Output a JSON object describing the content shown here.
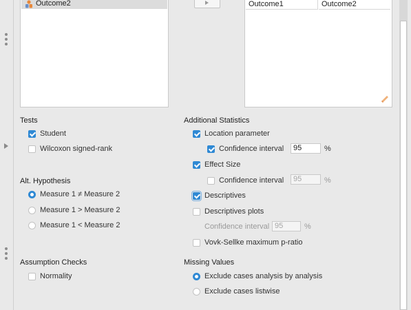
{
  "variables": {
    "items": [
      {
        "label": "Outcome2",
        "icon": "scale-variable-icon"
      }
    ]
  },
  "pairs": {
    "row1": {
      "a": "Outcome1",
      "b": "Outcome2"
    }
  },
  "tests": {
    "header": "Tests",
    "student": {
      "label": "Student",
      "checked": true
    },
    "wilcoxon": {
      "label": "Wilcoxon signed-rank",
      "checked": false
    }
  },
  "hypothesis": {
    "header": "Alt. Hypothesis",
    "options": [
      {
        "label": "Measure 1 ≠ Measure 2",
        "selected": true
      },
      {
        "label": "Measure 1 > Measure 2",
        "selected": false
      },
      {
        "label": "Measure 1 < Measure 2",
        "selected": false
      }
    ]
  },
  "assumptions": {
    "header": "Assumption Checks",
    "normality": {
      "label": "Normality",
      "checked": false
    }
  },
  "additional": {
    "header": "Additional Statistics",
    "location": {
      "label": "Location parameter",
      "checked": true
    },
    "location_ci": {
      "label": "Confidence interval",
      "value": "95",
      "unit": "%",
      "checked": true
    },
    "effect": {
      "label": "Effect Size",
      "checked": true
    },
    "effect_ci": {
      "label": "Confidence interval",
      "value": "95",
      "unit": "%",
      "checked": false
    },
    "descriptives": {
      "label": "Descriptives",
      "checked": true
    },
    "desc_plots": {
      "label": "Descriptives plots",
      "checked": false
    },
    "desc_plots_ci": {
      "label": "Confidence interval",
      "value": "95",
      "unit": "%"
    },
    "vovk": {
      "label": "Vovk-Sellke maximum p-ratio",
      "checked": false
    }
  },
  "missing": {
    "header": "Missing Values",
    "options": [
      {
        "label": "Exclude cases analysis by analysis",
        "selected": true
      },
      {
        "label": "Exclude cases listwise",
        "selected": false
      }
    ]
  },
  "colors": {
    "accent": "#2f89d4",
    "background": "#e9e9e9"
  }
}
